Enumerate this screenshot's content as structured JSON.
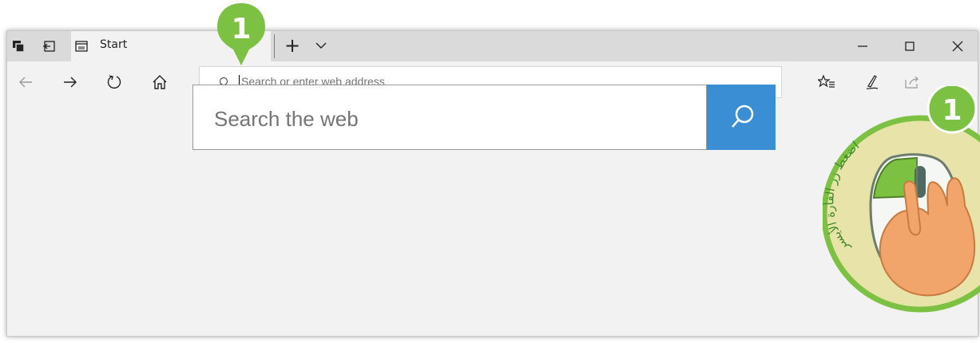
{
  "window": {
    "tab_title": "Start",
    "icons": [
      "tab-preview-icon",
      "set-aside-tabs-icon",
      "page-icon",
      "new-tab-icon",
      "tab-list-chevron-icon",
      "minimize-icon",
      "maximize-icon",
      "close-icon"
    ]
  },
  "navbar": {
    "icons": [
      "back-icon",
      "forward-icon",
      "refresh-icon",
      "home-icon",
      "favorites-icon",
      "pen-icon",
      "share-icon"
    ],
    "address_placeholder": "Search or enter web address"
  },
  "page": {
    "search_placeholder": "Search the web",
    "search_button_icon": "search-icon"
  },
  "annotations": {
    "step_number": "1",
    "mouse_instruction": "اضغط زر الفأرة الأيسر",
    "pin_color": "#7cc142",
    "badge_border_color": "#7cc142"
  },
  "colors": {
    "search_button": "#3a8fd4",
    "chrome_bg": "#dadada",
    "content_bg": "#f2f2f2"
  }
}
